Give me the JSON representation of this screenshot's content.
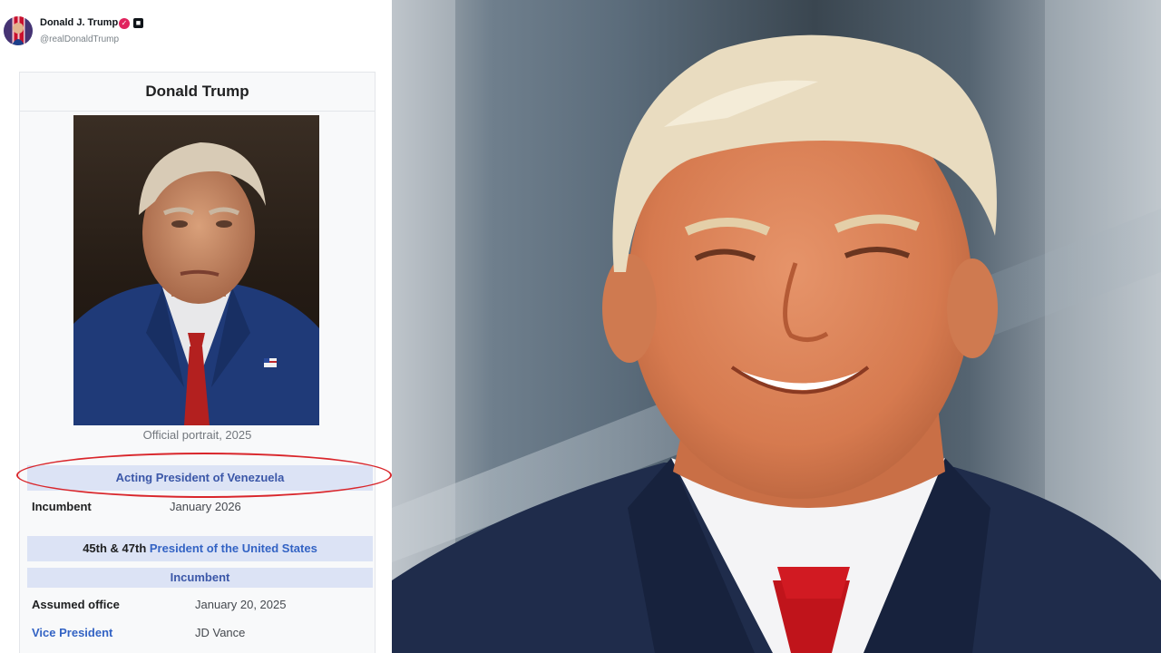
{
  "post": {
    "author_name": "Donald J. Trump",
    "author_handle": "@realDonaldTrump"
  },
  "infobox": {
    "title": "Donald Trump",
    "image_caption": "Official portrait, 2025",
    "section1": {
      "header": "Acting President of Venezuela",
      "label": "Incumbent",
      "value": "January 2026"
    },
    "section2": {
      "header_prefix": "45th & 47th",
      "header_link": "President of the United States",
      "subheader": "Incumbent",
      "row1_label": "Assumed office",
      "row1_value": "January 20, 2025",
      "row2_label": "Vice President",
      "row2_value": "JD Vance"
    }
  },
  "colors": {
    "highlight_ellipse": "#d9262b",
    "link": "#3363c4",
    "section_header_bg": "#dce3f5"
  },
  "icons": {
    "verified": "verified-badge-icon",
    "affiliate": "affiliate-badge-icon"
  }
}
